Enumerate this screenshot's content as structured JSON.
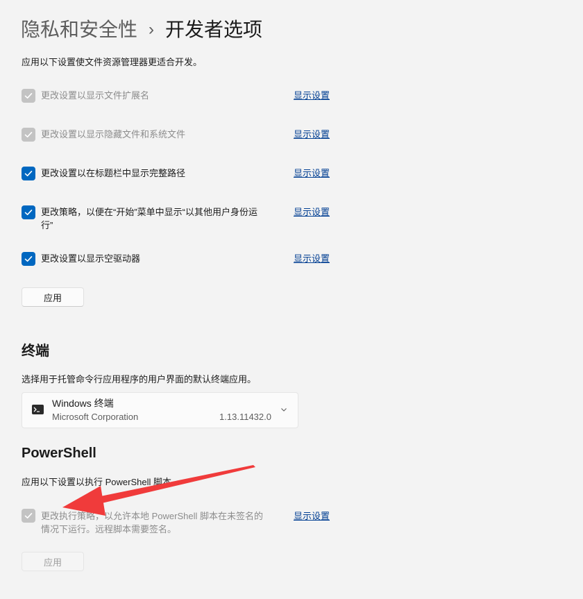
{
  "header": {
    "breadcrumb_parent": "隐私和安全性",
    "breadcrumb_separator": "›",
    "breadcrumb_current": "开发者选项"
  },
  "file_explorer": {
    "description": "应用以下设置使文件资源管理器更适合开发。",
    "options": [
      {
        "label": "更改设置以显示文件扩展名",
        "label_line2": "",
        "state": "checked-disabled",
        "link": "显示设置"
      },
      {
        "label": "更改设置以显示隐藏文件和系统文件",
        "label_line2": "",
        "state": "checked-disabled",
        "link": "显示设置"
      },
      {
        "label": "更改设置以在标题栏中显示完整路径",
        "label_line2": "",
        "state": "checked",
        "link": "显示设置"
      },
      {
        "label": "更改策略，以便在“开始”菜单中显示“以其他用户身份运",
        "label_line2": "行”",
        "state": "checked",
        "link": "显示设置"
      },
      {
        "label": "更改设置以显示空驱动器",
        "label_line2": "",
        "state": "checked",
        "link": "显示设置"
      }
    ],
    "apply_label": "应用"
  },
  "terminal": {
    "heading": "终端",
    "description": "选择用于托管命令行应用程序的用户界面的默认终端应用。",
    "selected_app": {
      "name": "Windows 终端",
      "publisher": "Microsoft Corporation",
      "version": "1.13.11432.0",
      "icon": "terminal-icon"
    }
  },
  "powershell": {
    "heading": "PowerShell",
    "description": "应用以下设置以执行 PowerShell 脚本。",
    "option": {
      "label": "更改执行策略，以允许本地 PowerShell 脚本在未签名的",
      "label_line2": "情况下运行。远程脚本需要签名。",
      "state": "checked-disabled",
      "link": "显示设置"
    },
    "apply_label": "应用"
  },
  "annotation": {
    "color": "#f03b3b",
    "icon": "red-arrow-annotation"
  },
  "colors": {
    "accent": "#0067c0",
    "link": "#003e92",
    "disabled": "#c3c3c3"
  }
}
